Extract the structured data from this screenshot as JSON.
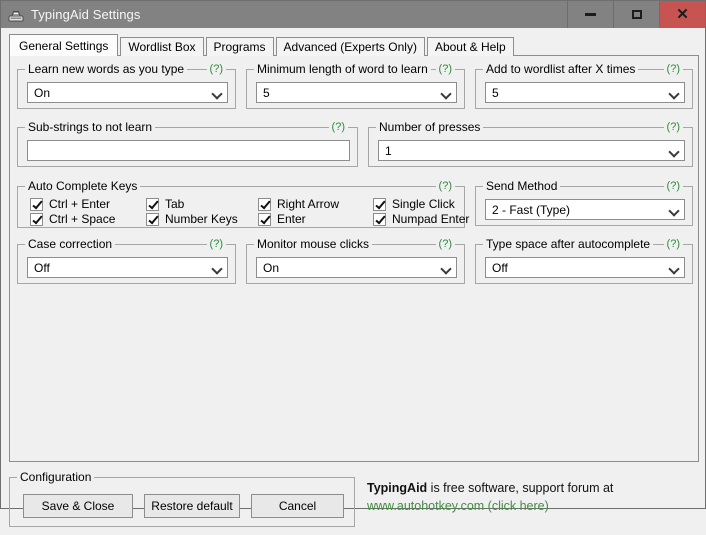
{
  "window": {
    "title": "TypingAid Settings",
    "icon": "typewriter-icon",
    "minimize_label": "–",
    "maximize_label": "☐",
    "close_label": "✕"
  },
  "tabs": [
    {
      "label": "General Settings",
      "active": true
    },
    {
      "label": "Wordlist Box",
      "active": false
    },
    {
      "label": "Programs",
      "active": false
    },
    {
      "label": "Advanced (Experts Only)",
      "active": false
    },
    {
      "label": "About & Help",
      "active": false
    }
  ],
  "help_marker": "(?)",
  "groups": {
    "learn_new_words": {
      "legend": "Learn new words as you type",
      "value": "On"
    },
    "minimum_length": {
      "legend": "Minimum length of word to learn",
      "value": "5"
    },
    "add_to_wordlist": {
      "legend": "Add to wordlist after X times",
      "value": "5"
    },
    "substrings": {
      "legend": "Sub-strings to not learn",
      "value": "",
      "placeholder": ""
    },
    "number_of_presses": {
      "legend": "Number of presses",
      "value": "1"
    },
    "auto_complete_keys": {
      "legend": "Auto Complete Keys",
      "checkboxes": [
        {
          "label": "Ctrl + Enter",
          "checked": true
        },
        {
          "label": "Ctrl + Space",
          "checked": true
        },
        {
          "label": "Tab",
          "checked": true
        },
        {
          "label": "Number Keys",
          "checked": true
        },
        {
          "label": "Right Arrow",
          "checked": true
        },
        {
          "label": "Enter",
          "checked": true
        },
        {
          "label": "Single Click",
          "checked": true
        },
        {
          "label": "Numpad Enter",
          "checked": true
        }
      ]
    },
    "send_method": {
      "legend": "Send Method",
      "value": "2 - Fast (Type)"
    },
    "case_correction": {
      "legend": "Case correction",
      "value": "Off"
    },
    "monitor_mouse_clicks": {
      "legend": "Monitor mouse clicks",
      "value": "On"
    },
    "type_space_after": {
      "legend": "Type space after autocomplete",
      "value": "Off"
    }
  },
  "bottom": {
    "config_legend": "Configuration",
    "save_label": "Save & Close",
    "restore_label": "Restore default",
    "cancel_label": "Cancel",
    "promo_brand": "TypingAid",
    "promo_text": " is free software, support forum at",
    "promo_link": "www.autohotkey.com (click here)"
  },
  "colors": {
    "titlebar": "#828282",
    "close_button": "#c75450",
    "help_green": "#2e8b3d",
    "link_green": "#3f8f3f",
    "client_bg": "#f0f0f0"
  }
}
